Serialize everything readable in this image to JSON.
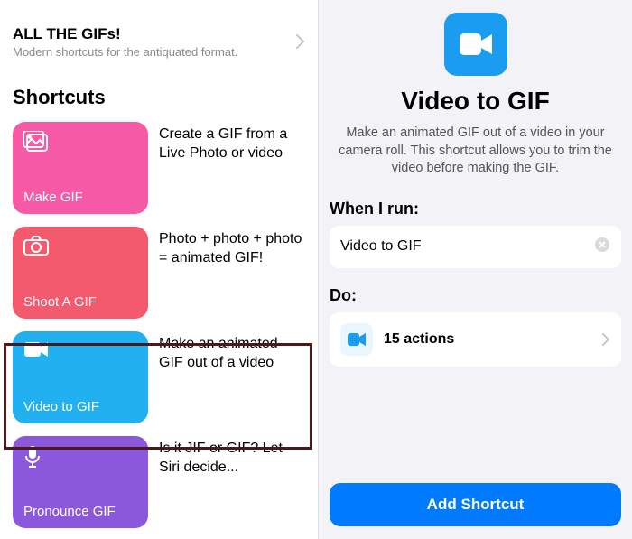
{
  "left": {
    "header": {
      "title": "ALL THE GIFs!",
      "subtitle": "Modern shortcuts for the antiquated format."
    },
    "section_title": "Shortcuts",
    "shortcuts": [
      {
        "label": "Make GIF",
        "desc": "Create a GIF from a Live Photo or video"
      },
      {
        "label": "Shoot A GIF",
        "desc": "Photo + photo + photo = animated GIF!"
      },
      {
        "label": "Video to GIF",
        "desc": "Make an animated GIF out of a video"
      },
      {
        "label": "Pronounce GIF",
        "desc": "Is it JIF or GIF? Let Siri decide..."
      }
    ]
  },
  "right": {
    "title": "Video to GIF",
    "description": "Make an animated GIF out of a video in your camera roll. This shortcut allows you to trim the video before making the GIF.",
    "when_label": "When I run:",
    "when_value": "Video to GIF",
    "do_label": "Do:",
    "actions_count": "15 actions",
    "add_button": "Add Shortcut"
  }
}
